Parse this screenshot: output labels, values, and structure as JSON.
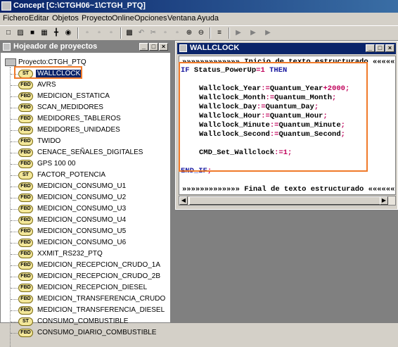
{
  "window": {
    "title": "Concept [C:\\CTGH06~1\\CTGH_PTQ]"
  },
  "menu": [
    "Fichero",
    "Editar",
    "Objetos",
    "Proyecto",
    "Online",
    "Opciones",
    "Ventana",
    "Ayuda"
  ],
  "toolbar": {
    "icons": [
      "new-file-icon",
      "open-folder-icon",
      "save-icon",
      "project-icon",
      "tree-icon",
      "find-icon",
      "copy-section-icon",
      "paste-section-icon",
      "transfer-icon",
      "undo-icon",
      "cut-icon",
      "copy-icon",
      "paste-icon",
      "zoom-in-icon",
      "zoom-out-icon",
      "number-icon",
      "step-icon",
      "step-into-icon",
      "run-icon"
    ]
  },
  "project": {
    "title": "Hojeador de proyectos",
    "root": "Proyecto:CTGH_PTQ",
    "sections": [
      {
        "type": "ST",
        "name": "WALLCLOCK",
        "selected": true
      },
      {
        "type": "FBD",
        "name": "AVRS"
      },
      {
        "type": "FBD",
        "name": "MEDICION_ESTATICA"
      },
      {
        "type": "FBD",
        "name": "SCAN_MEDIDORES"
      },
      {
        "type": "FBD",
        "name": "MEDIDORES_TABLEROS"
      },
      {
        "type": "FBD",
        "name": "MEDIDORES_UNIDADES"
      },
      {
        "type": "FBD",
        "name": "TWIDO"
      },
      {
        "type": "FBD",
        "name": "CENACE_SEÑALES_DIGITALES"
      },
      {
        "type": "FBD",
        "name": "GPS 100 00"
      },
      {
        "type": "ST",
        "name": "FACTOR_POTENCIA"
      },
      {
        "type": "FBD",
        "name": "MEDICION_CONSUMO_U1"
      },
      {
        "type": "FBD",
        "name": "MEDICION_CONSUMO_U2"
      },
      {
        "type": "FBD",
        "name": "MEDICION_CONSUMO_U3"
      },
      {
        "type": "FBD",
        "name": "MEDICION_CONSUMO_U4"
      },
      {
        "type": "FBD",
        "name": "MEDICION_CONSUMO_U5"
      },
      {
        "type": "FBD",
        "name": "MEDICION_CONSUMO_U6"
      },
      {
        "type": "FBD",
        "name": "XXMIT_RS232_PTQ"
      },
      {
        "type": "FBD",
        "name": "MEDICION_RECEPCION_CRUDO_1A"
      },
      {
        "type": "FBD",
        "name": "MEDICION_RECEPCION_CRUDO_2B"
      },
      {
        "type": "FBD",
        "name": "MEDICION_RECEPCION_DIESEL"
      },
      {
        "type": "FBD",
        "name": "MEDICION_TRANSFERENCIA_CRUDO"
      },
      {
        "type": "FBD",
        "name": "MEDICION_TRANSFERENCIA_DIESEL"
      },
      {
        "type": "ST",
        "name": "CONSUMO_COMBUSTIBLE"
      },
      {
        "type": "FBD",
        "name": "CONSUMO_DIARIO_COMBUSTIBLE"
      }
    ]
  },
  "editor": {
    "title": "WALLCLOCK",
    "header_comment": "»»»»»»»»»»»»» Inicio de texto estructurado «««««««",
    "footer_comment": "»»»»»»»»»»»»» Final de texto estructurado «««««««",
    "code": [
      {
        "kw": "IF",
        "rest": " Status_PowerUp",
        "op": "=",
        "num": "1",
        "tail": " ",
        "kw2": "THEN"
      },
      {
        "var": "Wallclock_Year",
        "expr": "Quantum_Year",
        "plus": "+",
        "num": "2000"
      },
      {
        "var": "Wallclock_Month",
        "expr": "Quantum_Month"
      },
      {
        "var": "Wallclock_Day",
        "expr": "Quantum_Day"
      },
      {
        "var": "Wallclock_Hour",
        "expr": "Quantum_Hour"
      },
      {
        "var": "Wallclock_Minute",
        "expr": "Quantum_Minute"
      },
      {
        "var": "Wallclock_Second",
        "expr": "Quantum_Second"
      },
      {
        "var": "CMD_Set_Wallclock",
        "num": "1"
      },
      {
        "kw": "END_IF"
      }
    ],
    "assign_op": ":=",
    "terminator": ";"
  },
  "colors": {
    "highlight": "#f07a2a",
    "title_active": "#0a246a",
    "keyword": "#1a1aa0",
    "operator": "#c0005a"
  }
}
